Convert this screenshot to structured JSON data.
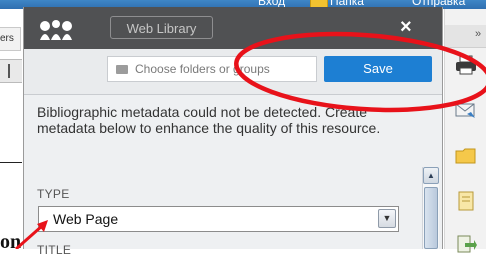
{
  "browser": {
    "menu_items": [
      "Вход",
      "Папка",
      "Отправка"
    ],
    "left_tab_label": "ers",
    "left_text_fragment": "on",
    "right_toolbar_chevron": "»",
    "right_toolbar_icons": [
      "printer-icon",
      "mail-icon",
      "folder-icon",
      "notes-icon",
      "forward-icon"
    ]
  },
  "zotero": {
    "library_button": "Web Library",
    "close": "×",
    "folder_placeholder": "Choose folders or groups",
    "save_label": "Save",
    "notice": "Bibliographic metadata could not be detected. Create metadata below to enhance the quality of this resource.",
    "type_label": "TYPE",
    "type_value": "Web Page",
    "title_label": "TITLE"
  },
  "colors": {
    "header": "#505153",
    "save_button": "#1d7fd3",
    "annotation": "#e8121a"
  }
}
